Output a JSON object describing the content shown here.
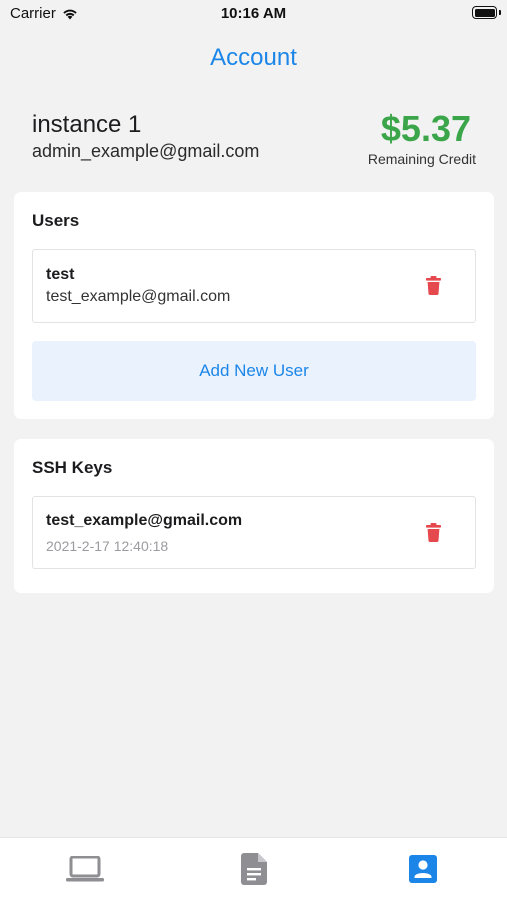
{
  "status_bar": {
    "carrier": "Carrier",
    "time": "10:16 AM"
  },
  "nav": {
    "title": "Account"
  },
  "account": {
    "instance_name": "instance 1",
    "email": "admin_example@gmail.com",
    "credit_amount": "$5.37",
    "credit_label": "Remaining Credit"
  },
  "users_section": {
    "title": "Users",
    "users": [
      {
        "name": "test",
        "email": "test_example@gmail.com"
      }
    ],
    "add_button_label": "Add New User"
  },
  "ssh_section": {
    "title": "SSH Keys",
    "keys": [
      {
        "name": "test_example@gmail.com",
        "date": "2021-2-17 12:40:18"
      }
    ]
  },
  "tab_bar": {
    "tabs": [
      {
        "icon": "laptop-icon",
        "active": false
      },
      {
        "icon": "document-icon",
        "active": false
      },
      {
        "icon": "account-icon",
        "active": true
      }
    ]
  },
  "colors": {
    "accent": "#1c86e8",
    "credit_green": "#3ba54a",
    "delete_red": "#e5484d",
    "inactive_gray": "#8e8e93",
    "background": "#f2f2f3"
  }
}
